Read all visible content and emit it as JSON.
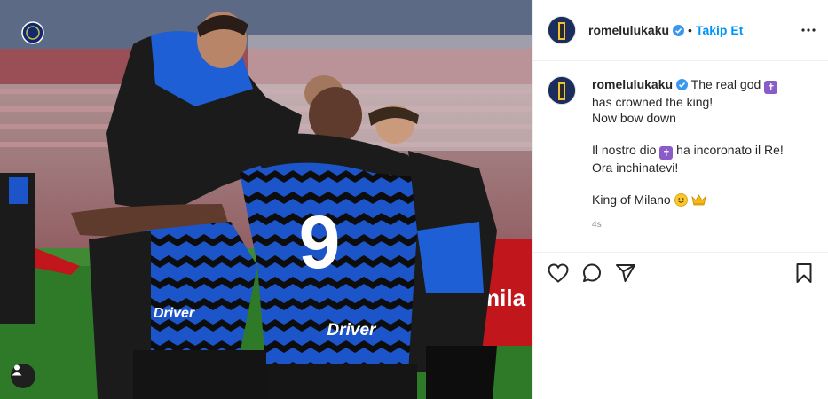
{
  "post": {
    "username": "romelulukaku",
    "follow_label": "Takip Et",
    "separator": "•",
    "caption": {
      "line1_text": "The real god",
      "line1_emoji": "✝",
      "line2": "has crowned the king!",
      "line3": "Now bow down",
      "para2_line1_before": "Il nostro dio",
      "para2_emoji": "✝",
      "para2_line1_after": "ha incoronato il Re!",
      "para2_line2": "Ora inchinatevi!",
      "para3": "King of Milano"
    },
    "timestamp": "4s"
  },
  "photo": {
    "jersey_number": "9",
    "sponsor": "Driver",
    "sponsor_left": "Driver",
    "board_text": "mila"
  },
  "icons": {
    "verified": "verified-badge-icon",
    "more": "more-options-icon",
    "like": "heart-icon",
    "comment": "comment-icon",
    "share": "share-icon",
    "save": "bookmark-icon",
    "tag": "user-tag-icon"
  },
  "colors": {
    "accent": "#0095f6",
    "inter_blue": "#1d4fbf",
    "inter_black": "#111111"
  }
}
